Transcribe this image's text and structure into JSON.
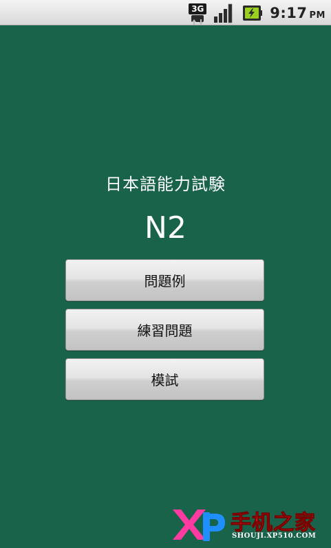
{
  "status_bar": {
    "network_label": "3G",
    "time": "9:17",
    "ampm": "PM",
    "icons": [
      "3g-data-icon",
      "signal-strength-icon",
      "battery-charging-icon"
    ]
  },
  "main": {
    "title": "日本語能力試験",
    "level": "N2",
    "buttons": [
      {
        "label": "問題例"
      },
      {
        "label": "練習問題"
      },
      {
        "label": "模試"
      }
    ]
  },
  "watermark": {
    "logo_text": "XP",
    "chinese_text": "手机之家",
    "site_text": "SHOUJI.XP510.COM"
  },
  "colors": {
    "background": "#18634a",
    "status_bar": "#e6e6e6",
    "button_face": "#d9d9d9",
    "watermark_red": "#ff2a2a",
    "logo_pink": "#ff3aa0",
    "logo_blue": "#1f8fff"
  }
}
